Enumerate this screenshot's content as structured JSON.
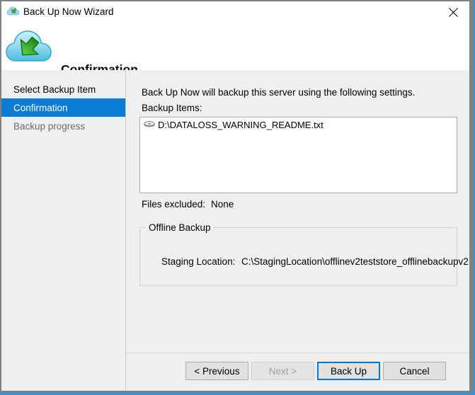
{
  "window": {
    "title": "Back Up Now Wizard",
    "title_icon": "cloud-backup-icon",
    "close_icon": "close-icon"
  },
  "header": {
    "icon": "cloud-restore-arrow-icon",
    "title": "Confirmation"
  },
  "sidebar": {
    "items": [
      {
        "label": "Select Backup Item",
        "state": "normal"
      },
      {
        "label": "Confirmation",
        "state": "selected"
      },
      {
        "label": "Backup progress",
        "state": "disabled"
      }
    ]
  },
  "main": {
    "intro_text": "Back Up Now will backup this server using the following settings.",
    "backup_items_label": "Backup Items:",
    "backup_items": [
      {
        "icon": "disk-drive-icon",
        "path": "D:\\DATALOSS_WARNING_README.txt"
      }
    ],
    "files_excluded": {
      "label": "Files excluded:",
      "value": "None"
    },
    "offline_backup": {
      "group_label": "Offline Backup",
      "staging_label": "Staging Location:",
      "staging_value": "C:\\StagingLocation\\offlinev2teststore_offlinebackupv2"
    }
  },
  "footer": {
    "buttons": [
      {
        "label": "< Previous",
        "state": "enabled"
      },
      {
        "label": "Next >",
        "state": "disabled"
      },
      {
        "label": "Back Up",
        "state": "default"
      },
      {
        "label": "Cancel",
        "state": "enabled"
      }
    ]
  },
  "colors": {
    "selection_blue": "#0a7cd5",
    "default_button_border": "#0078d7",
    "window_border": "#808080",
    "body_background": "#efefef",
    "behind_window_blue": "#3f8fcc"
  }
}
